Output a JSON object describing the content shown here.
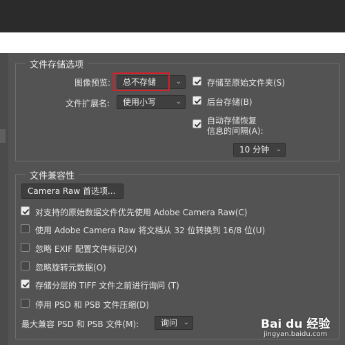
{
  "colors": {
    "panel_bg": "#535353",
    "top_bar": "#2b2b2b",
    "highlight": "#d3202a"
  },
  "storage": {
    "title": "文件存储选项",
    "image_preview": {
      "label": "图像预览:",
      "value": "总不存储"
    },
    "file_extension": {
      "label": "文件扩展名:",
      "value": "使用小写"
    },
    "save_to_original_folder": {
      "label": "存储至原始文件夹(S)",
      "checked": true
    },
    "background_save": {
      "label": "后台存储(B)",
      "checked": true
    },
    "auto_save_recovery": {
      "label_line1": "自动存储恢复",
      "label_line2": "信息的间隔(A):",
      "checked": true
    },
    "interval": {
      "value": "10 分钟"
    }
  },
  "compat": {
    "title": "文件兼容性",
    "camera_raw_button": "Camera Raw 首选项...",
    "options": [
      {
        "label": "对支持的原始数据文件优先使用 Adobe Camera Raw(C)",
        "checked": true
      },
      {
        "label": "使用 Adobe Camera Raw 将文档从 32 位转换到 16/8 位(U)",
        "checked": false
      },
      {
        "label": "忽略 EXIF 配置文件标记(X)",
        "checked": false
      },
      {
        "label": "忽略旋转元数据(O)",
        "checked": false
      },
      {
        "label": "存储分层的 TIFF 文件之前进行询问 (T)",
        "checked": true
      },
      {
        "label": "停用 PSD 和 PSB 文件压缩(D)",
        "checked": false
      }
    ],
    "max_compat": {
      "label": "最大兼容 PSD 和 PSB 文件(M):",
      "value": "询问"
    }
  },
  "watermark": {
    "main": "Bai du 经验",
    "sub": "jingyan.baidu.com"
  }
}
